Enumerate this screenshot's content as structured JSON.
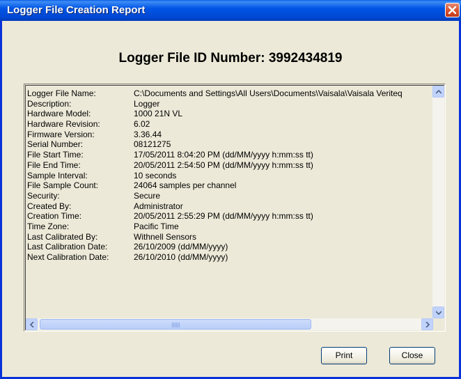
{
  "window": {
    "title": "Logger File Creation Report"
  },
  "heading": "Logger File ID Number: 3992434819",
  "report": {
    "rows": [
      {
        "label": "Logger File Name:",
        "value": "C:\\Documents and Settings\\All Users\\Documents\\Vaisala\\Vaisala Veriteq"
      },
      {
        "label": "Description:",
        "value": "Logger"
      },
      {
        "label": "Hardware Model:",
        "value": "1000 21N VL"
      },
      {
        "label": "Hardware Revision:",
        "value": "6.02"
      },
      {
        "label": "Firmware Version:",
        "value": "3.36.44"
      },
      {
        "label": "Serial Number:",
        "value": "08121275"
      },
      {
        "label": "File Start Time:",
        "value": "17/05/2011 8:04:20 PM  (dd/MM/yyyy h:mm:ss tt)"
      },
      {
        "label": "File End Time:",
        "value": "20/05/2011 2:54:50 PM  (dd/MM/yyyy h:mm:ss tt)"
      },
      {
        "label": "Sample Interval:",
        "value": "10 seconds"
      },
      {
        "label": "File Sample Count:",
        "value": "24064 samples per channel"
      },
      {
        "label": "Security:",
        "value": "Secure"
      },
      {
        "label": "Created By:",
        "value": "Administrator"
      },
      {
        "label": "Creation Time:",
        "value": "20/05/2011 2:55:29 PM  (dd/MM/yyyy h:mm:ss tt)"
      },
      {
        "label": "Time Zone:",
        "value": "Pacific Time"
      },
      {
        "label": "Last Calibrated By:",
        "value": "Withnell Sensors"
      },
      {
        "label": "Last Calibration Date:",
        "value": "26/10/2009  (dd/MM/yyyy)"
      },
      {
        "label": "Next Calibration Date:",
        "value": "26/10/2010  (dd/MM/yyyy)"
      }
    ]
  },
  "buttons": {
    "print": "Print",
    "close": "Close"
  },
  "icons": {
    "close": "close-x-icon",
    "scroll_up": "arrow-up-icon",
    "scroll_down": "arrow-down-icon",
    "scroll_left": "arrow-left-icon",
    "scroll_right": "arrow-right-icon"
  },
  "colors": {
    "titlebar": "#0055e5",
    "close_button": "#d9502c",
    "window_bg": "#ece9d8"
  }
}
